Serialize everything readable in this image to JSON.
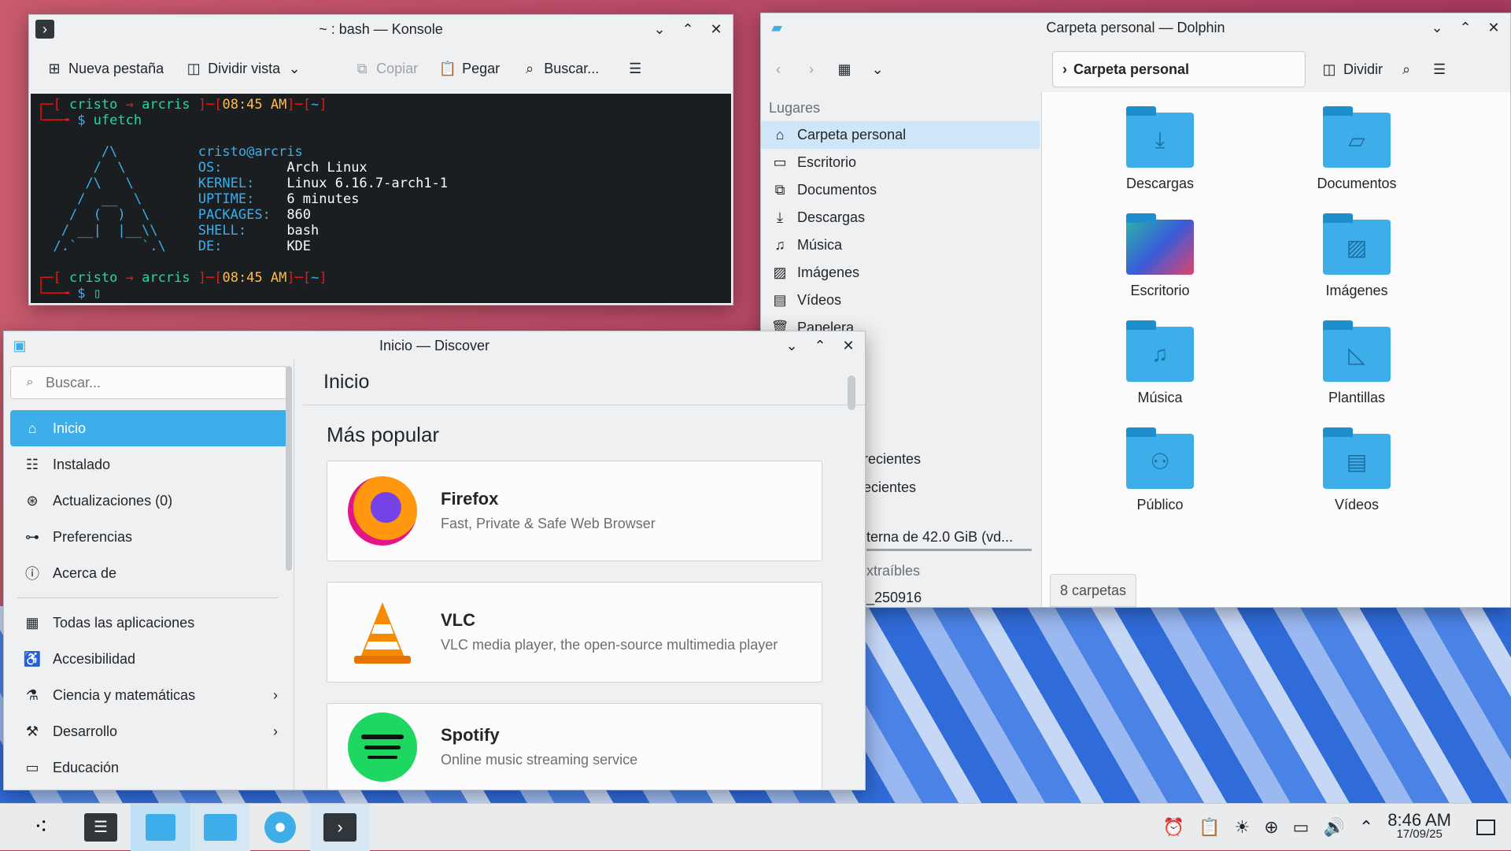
{
  "konsole": {
    "title": "~ : bash — Konsole",
    "toolbar": {
      "new_tab": "Nueva pestaña",
      "split_view": "Dividir vista",
      "copy": "Copiar",
      "paste": "Pegar",
      "search": "Buscar..."
    },
    "prompt_user": "cristo",
    "prompt_host": "arcris",
    "prompt_time": "08:45 AM",
    "prompt_dir": "~",
    "command": "ufetch",
    "fetch": {
      "userhost": "cristo@arcris",
      "os_label": "OS:",
      "os": "Arch Linux",
      "kernel_label": "KERNEL:",
      "kernel": "Linux 6.16.7-arch1-1",
      "uptime_label": "UPTIME:",
      "uptime": "6 minutes",
      "packages_label": "PACKAGES:",
      "packages": "860",
      "shell_label": "SHELL:",
      "shell": "bash",
      "de_label": "DE:",
      "de": "KDE"
    }
  },
  "dolphin": {
    "title": "Carpeta personal — Dolphin",
    "breadcrumb": "Carpeta personal",
    "split": "Dividir",
    "places_header": "Lugares",
    "places": [
      "Carpeta personal",
      "Escritorio",
      "Documentos",
      "Descargas",
      "Música",
      "Imágenes",
      "Vídeos",
      "Papelera"
    ],
    "partial": [
      "recientes",
      "ecientes",
      "terna de 42.0 GiB (vd...",
      "xtraíbles",
      "_250916"
    ],
    "folders": [
      "Descargas",
      "Documentos",
      "Escritorio",
      "Imágenes",
      "Música",
      "Plantillas",
      "Público",
      "Vídeos"
    ],
    "status": "8 carpetas"
  },
  "discover": {
    "title": "Inicio — Discover",
    "search_placeholder": "Buscar...",
    "page_title": "Inicio",
    "nav": [
      "Inicio",
      "Instalado",
      "Actualizaciones (0)",
      "Preferencias",
      "Acerca de"
    ],
    "categories": [
      "Todas las aplicaciones",
      "Accesibilidad",
      "Ciencia y matemáticas",
      "Desarrollo",
      "Educación"
    ],
    "section": "Más popular",
    "apps": [
      {
        "name": "Firefox",
        "desc": "Fast, Private & Safe Web Browser"
      },
      {
        "name": "VLC",
        "desc": "VLC media player, the open-source multimedia player"
      },
      {
        "name": "Spotify",
        "desc": "Online music streaming service"
      }
    ]
  },
  "taskbar": {
    "time": "8:46 AM",
    "date": "17/09/25"
  }
}
